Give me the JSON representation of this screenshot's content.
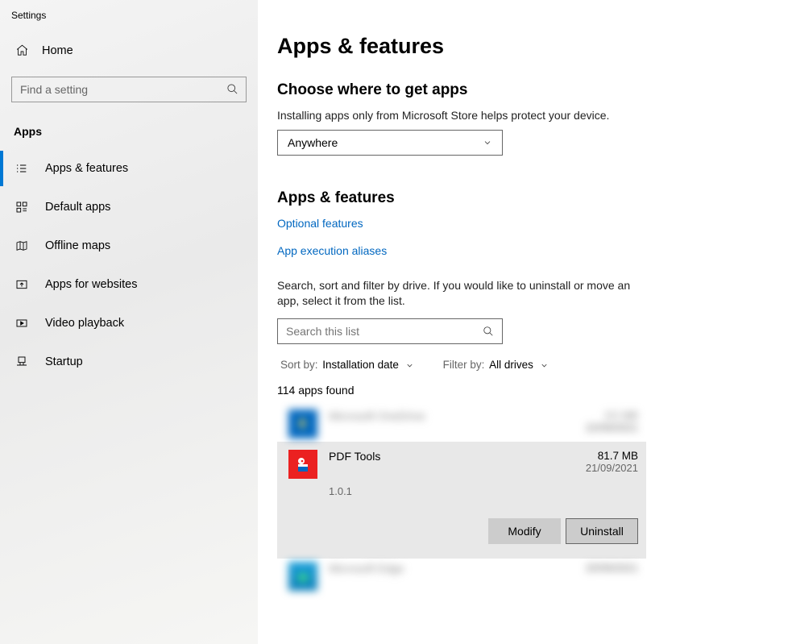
{
  "window_title": "Settings",
  "sidebar": {
    "home": "Home",
    "search_placeholder": "Find a setting",
    "category": "Apps",
    "items": [
      {
        "label": "Apps & features"
      },
      {
        "label": "Default apps"
      },
      {
        "label": "Offline maps"
      },
      {
        "label": "Apps for websites"
      },
      {
        "label": "Video playback"
      },
      {
        "label": "Startup"
      }
    ]
  },
  "main": {
    "title": "Apps & features",
    "choose": {
      "heading": "Choose where to get apps",
      "desc": "Installing apps only from Microsoft Store helps protect your device.",
      "selected": "Anywhere"
    },
    "features": {
      "heading": "Apps & features",
      "link_optional": "Optional features",
      "link_alias": "App execution aliases",
      "help": "Search, sort and filter by drive. If you would like to uninstall or move an app, select it from the list.",
      "search_placeholder": "Search this list",
      "sort_label": "Sort by:",
      "sort_value": "Installation date",
      "filter_label": "Filter by:",
      "filter_value": "All drives",
      "count": "114 apps found"
    },
    "apps": [
      {
        "name": "Microsoft OneDrive",
        "size": "XX MB",
        "date": "22/09/2021"
      },
      {
        "name": "PDF Tools",
        "size": "81.7 MB",
        "date": "21/09/2021",
        "version": "1.0.1"
      },
      {
        "name": "Microsoft Edge",
        "size": "",
        "date": "20/09/2021"
      }
    ],
    "btn_modify": "Modify",
    "btn_uninstall": "Uninstall"
  }
}
